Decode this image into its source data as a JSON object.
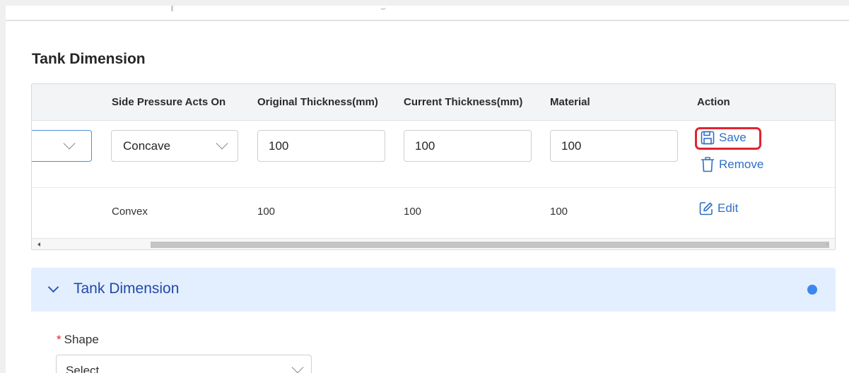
{
  "section": {
    "title": "Tank Dimension"
  },
  "table": {
    "headers": [
      "Side Pressure Acts On",
      "Original Thickness(mm)",
      "Current Thickness(mm)",
      "Material",
      "Action"
    ],
    "edit_row": {
      "side_pressure": "Concave",
      "original_thickness": "100",
      "current_thickness": "100",
      "material": "100",
      "save_label": "Save",
      "remove_label": "Remove"
    },
    "rows": [
      {
        "side_pressure": "Convex",
        "original_thickness": "100",
        "current_thickness": "100",
        "material": "100",
        "edit_label": "Edit"
      }
    ]
  },
  "panel": {
    "title": "Tank Dimension"
  },
  "form": {
    "shape_label": "Shape",
    "required_mark": "*",
    "shape_placeholder": "Select"
  },
  "colors": {
    "accent": "#2f6fc6",
    "highlight": "#e0242f",
    "panel_bg": "#e3efff",
    "panel_text": "#2249a8",
    "dot": "#3b86f0"
  },
  "icons": {
    "save": "save-icon",
    "remove": "trash-icon",
    "edit": "edit-icon",
    "dropdown": "chevron-down-icon"
  }
}
